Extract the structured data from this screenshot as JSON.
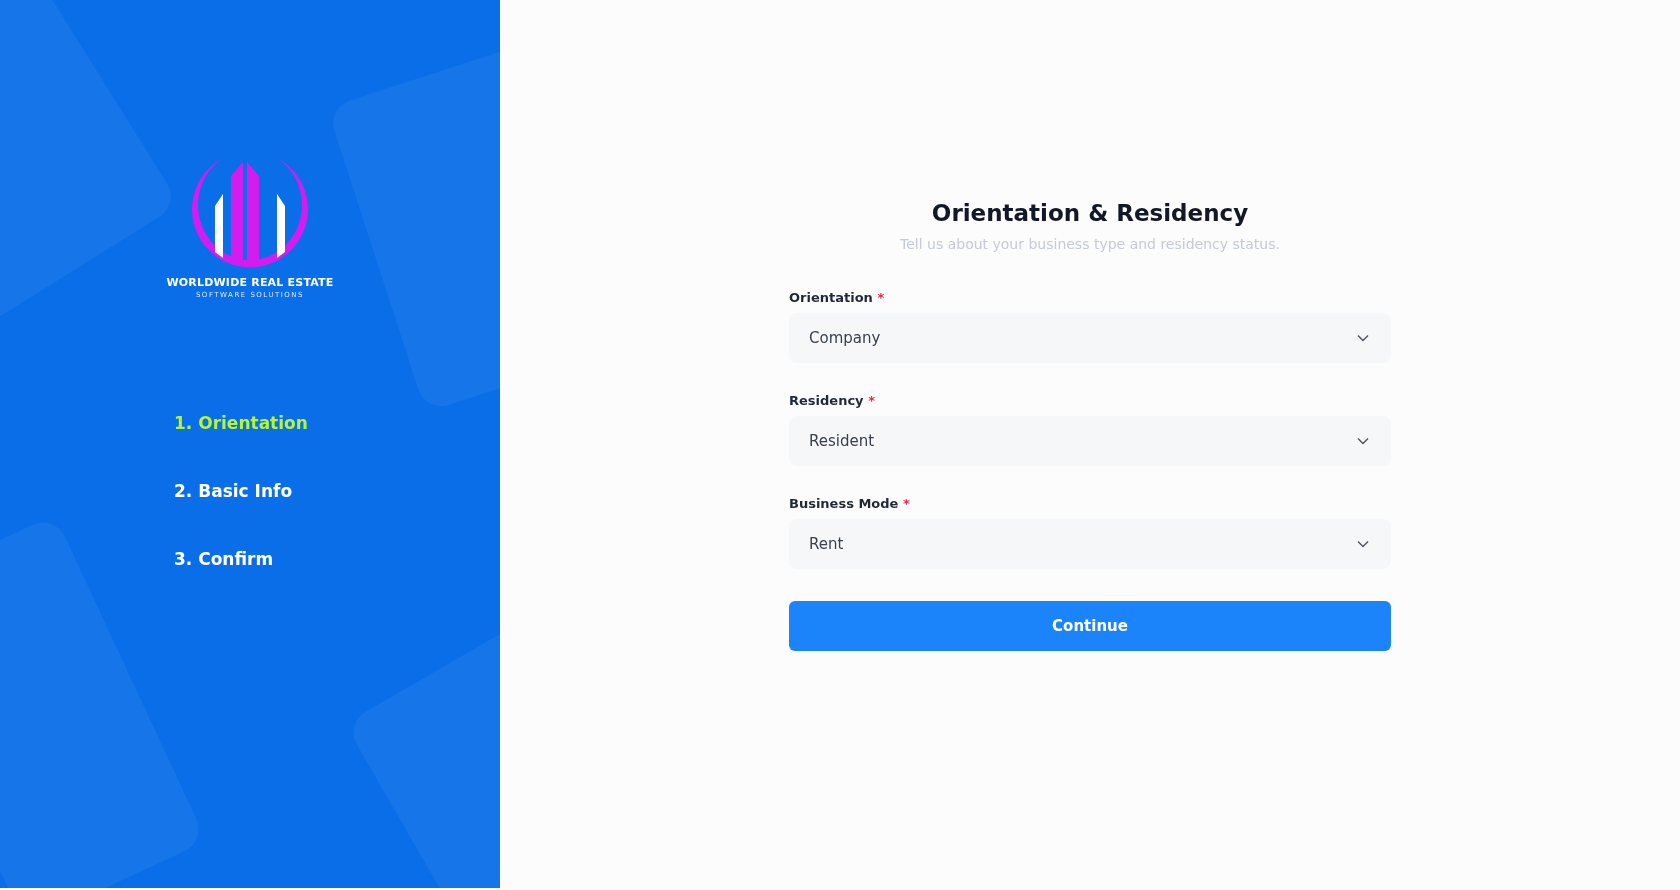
{
  "brand": {
    "name": "WORLDWIDE REAL ESTATE",
    "tagline": "SOFTWARE SOLUTIONS"
  },
  "steps": [
    {
      "label": "1. Orientation",
      "selected": true
    },
    {
      "label": "2. Basic Info",
      "selected": false
    },
    {
      "label": "3. Confirm",
      "selected": false
    }
  ],
  "form": {
    "title": "Orientation & Residency",
    "subtitle": "Tell us about your business type and residency status.",
    "fields": [
      {
        "label": "Orientation",
        "required_mark": "*",
        "value": "Company"
      },
      {
        "label": "Residency",
        "required_mark": "*",
        "value": "Resident"
      },
      {
        "label": "Business Mode",
        "required_mark": "*",
        "value": "Rent"
      }
    ],
    "submit": "Continue"
  }
}
